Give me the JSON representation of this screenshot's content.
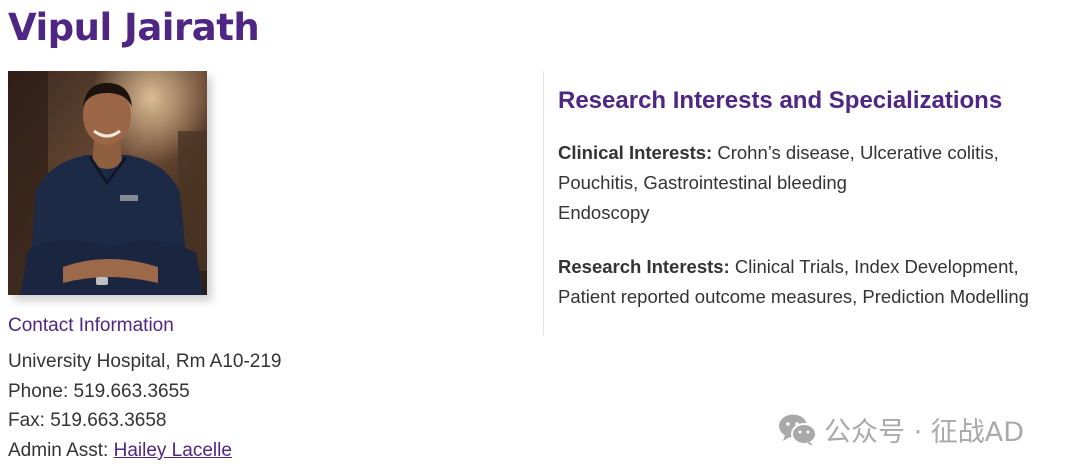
{
  "profile": {
    "name": "Vipul Jairath",
    "photo_alt": "Portrait of Vipul Jairath"
  },
  "contact": {
    "heading": "Contact Information",
    "address": "University Hospital, Rm A10-219",
    "phone": "Phone: 519.663.3655",
    "fax": "Fax: 519.663.3658",
    "admin_label": "Admin Asst: ",
    "admin_name": "Hailey Lacelle"
  },
  "research": {
    "heading": "Research Interests and Specializations",
    "clinical_label": "Clinical Interests:",
    "clinical_text": " Crohn’s disease, Ulcerative colitis, Pouchitis, Gastrointestinal bleeding",
    "clinical_extra": "Endoscopy",
    "research_label": "Research Interests:",
    "research_text": " Clinical Trials, Index Development, Patient reported outcome measures, Prediction Modelling"
  },
  "watermark": {
    "text": "公众号 · 征战AD",
    "icon": "wechat-icon"
  },
  "colors": {
    "accent": "#4f2683",
    "text": "#333333",
    "watermark": "#a9a9a9"
  }
}
